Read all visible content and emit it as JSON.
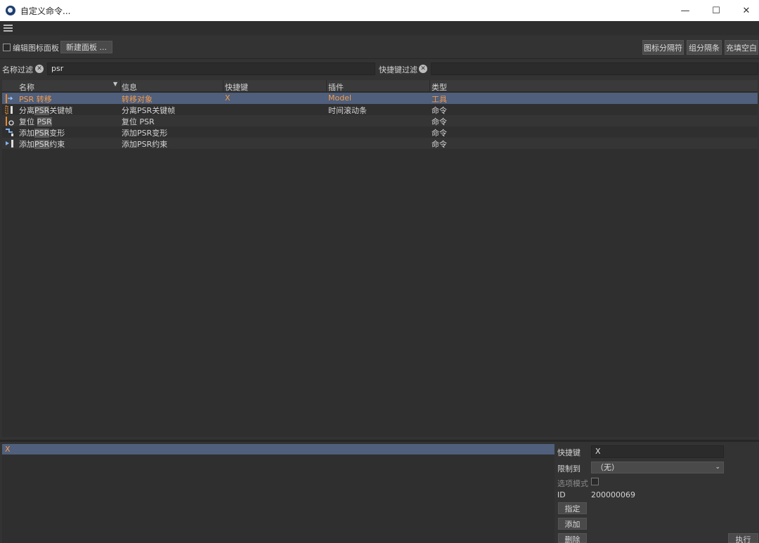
{
  "window": {
    "title": "自定义命令...",
    "controls": {
      "minimize": "—",
      "maximize": "☐",
      "close": "✕"
    }
  },
  "menubar": {
    "icon": "hamburger-menu-icon"
  },
  "toolbar": {
    "edit_palette_label": "编辑图标面板",
    "new_palette_button": "新建面板 ...",
    "icon_separator_button": "图标分隔符",
    "group_separator_button": "组分隔条",
    "fill_space_button": "充填空白"
  },
  "filters": {
    "name_filter_label": "名称过滤",
    "name_filter_value": "psr",
    "shortcut_filter_label": "快捷键过滤",
    "shortcut_filter_value": "",
    "clear_glyph": "✕"
  },
  "table": {
    "sort_arrow": "▼",
    "columns": [
      "名称",
      "信息",
      "快捷键",
      "插件",
      "类型"
    ],
    "rows": [
      {
        "icon": "psr-transfer-icon",
        "name_pre": "PSR 转移",
        "name_hl": "",
        "name_post": "",
        "info": "转移对象",
        "shortcut": "X",
        "plugin": "Model",
        "type": "工具"
      },
      {
        "icon": "separate-keyframes-icon",
        "name_pre": "分离",
        "name_hl": "PSR",
        "name_post": "关键帧",
        "info": "分离PSR关键帧",
        "shortcut": "",
        "plugin": "时间滚动条",
        "type": "命令"
      },
      {
        "icon": "reset-psr-icon",
        "name_pre": "复位 ",
        "name_hl": "PSR",
        "name_post": "",
        "info": "复位 PSR",
        "shortcut": "",
        "plugin": "",
        "type": "命令"
      },
      {
        "icon": "add-psr-deform-icon",
        "name_pre": "添加",
        "name_hl": "PSR",
        "name_post": "变形",
        "info": "添加PSR变形",
        "shortcut": "",
        "plugin": "",
        "type": "命令"
      },
      {
        "icon": "add-psr-constraint-icon",
        "name_pre": "添加",
        "name_hl": "PSR",
        "name_post": "约束",
        "info": "添加PSR约束",
        "shortcut": "",
        "plugin": "",
        "type": "命令"
      }
    ]
  },
  "shortcut_list": {
    "selected": "X"
  },
  "properties": {
    "shortcut_label": "快捷键",
    "shortcut_value": "X",
    "restrict_label": "限制到",
    "restrict_value": "（无）",
    "option_mode_label": "选项模式",
    "id_label": "ID",
    "id_value": "200000069",
    "assign_button": "指定",
    "add_button": "添加",
    "delete_button": "删除",
    "execute_button": "执行"
  },
  "colors": {
    "background": "#333333",
    "selection": "#4f5f7c",
    "selected_text": "#f39a4b"
  }
}
